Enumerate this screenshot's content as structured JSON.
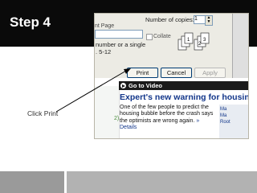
{
  "slide": {
    "title": "Step 4",
    "callout": "Click Print"
  },
  "print_dialog": {
    "page_label": "nt Page",
    "number_hint_line1": "number or a single",
    "number_hint_line2": ". 5-12",
    "copies_label": "Number of copies:",
    "copies_value": "1",
    "collate_label": "Collate",
    "collate_pages": [
      "1",
      "2",
      "3"
    ],
    "buttons": {
      "print": "Print",
      "cancel": "Cancel",
      "apply": "Apply"
    }
  },
  "web_content": {
    "go_to_video": "Go to Video",
    "headline": "Expert's new warning for housing",
    "body": "One of the few people to predict the housing bubble before the crash says the optimists are wrong again.",
    "details_link": "» Details",
    "sidebar_fragment": "2)",
    "right_links": [
      "Ma",
      "Ma",
      "Root"
    ]
  },
  "colors": {
    "top_band": "#0a0a0a",
    "headline_blue": "#12368a",
    "arrow": "#000000"
  }
}
